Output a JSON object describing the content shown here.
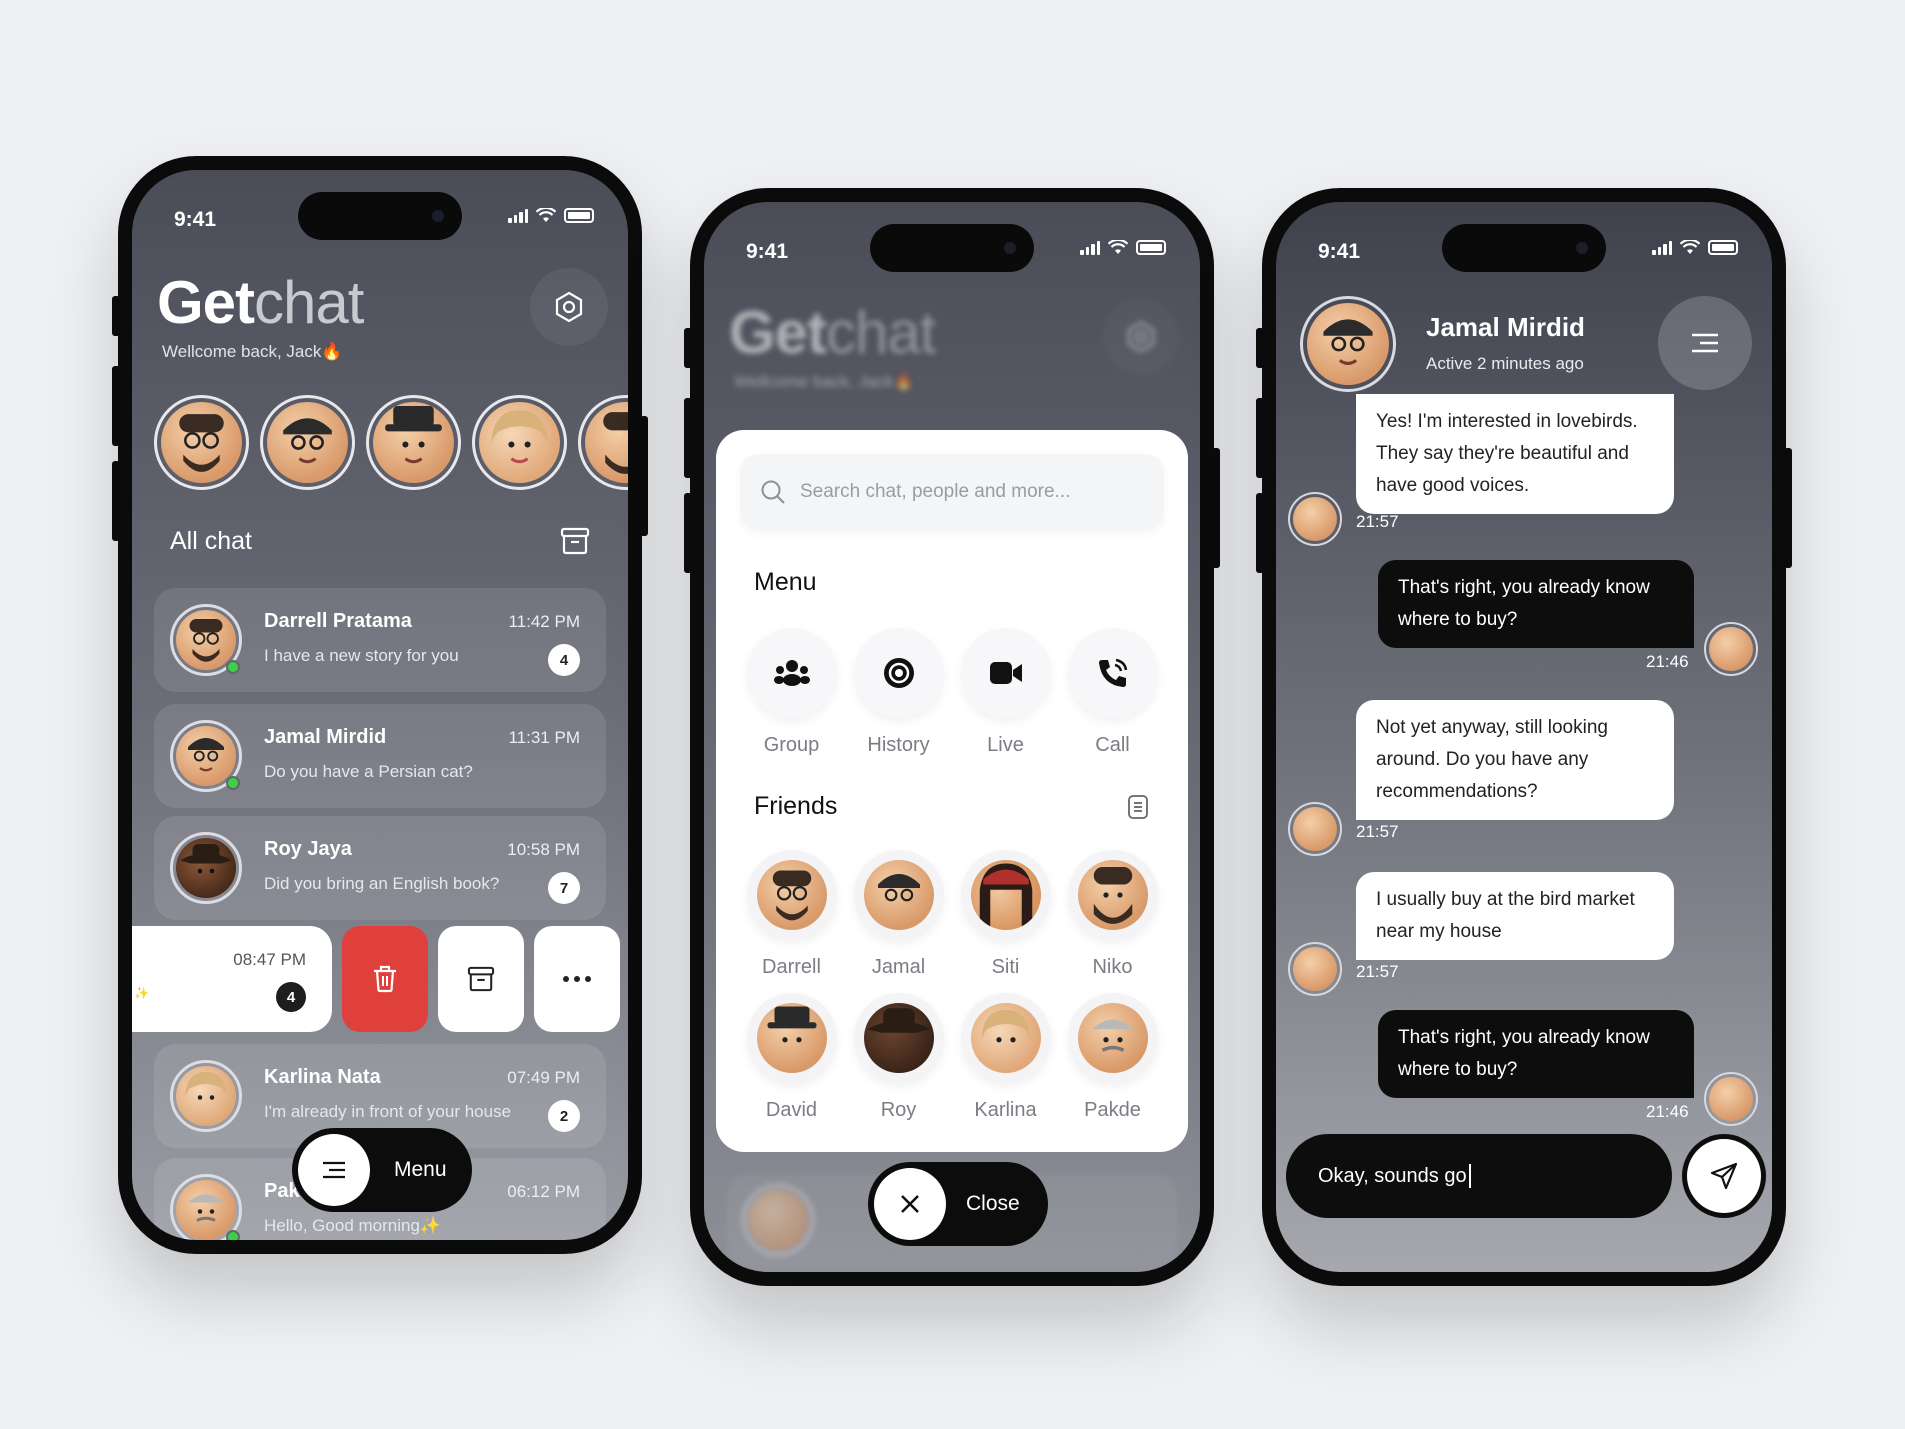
{
  "status_bar": {
    "time": "9:41"
  },
  "phone1": {
    "brand_bold": "Get",
    "brand_light": "chat",
    "welcome": "Wellcome back, Jack🔥",
    "section_title": "All chat",
    "chats": [
      {
        "name": "Darrell Pratama",
        "message": "I have a new story for you",
        "time": "11:42 PM",
        "badge": "4"
      },
      {
        "name": "Jamal Mirdid",
        "message": "Do you have a Persian cat?",
        "time": "11:31 PM",
        "badge": ""
      },
      {
        "name": "Roy Jaya",
        "message": "Did you bring an English book?",
        "time": "10:58 PM",
        "badge": "7"
      },
      {
        "name": "",
        "message": "",
        "time": "08:47 PM",
        "badge": "4"
      },
      {
        "name": "Karlina Nata",
        "message": "I'm already in front of your house",
        "time": "07:49 PM",
        "badge": "2"
      },
      {
        "name": "Pakde",
        "message": "Hello, Good morning✨",
        "time": "06:12 PM",
        "badge": ""
      }
    ],
    "fab_label": "Menu",
    "sparkle": "✨"
  },
  "phone2": {
    "search_placeholder": "Search chat, people and more...",
    "menu_title": "Menu",
    "menu_items": [
      "Group",
      "History",
      "Live",
      "Call"
    ],
    "friends_title": "Friends",
    "friends": [
      "Darrell",
      "Jamal",
      "Siti",
      "Niko",
      "David",
      "Roy",
      "Karlina",
      "Pakde"
    ],
    "close_label": "Close"
  },
  "phone3": {
    "contact_name": "Jamal Mirdid",
    "contact_status": "Active 2 minutes ago",
    "messages": [
      {
        "text": "Yes! I'm interested in lovebirds. They say they're beautiful and have good voices.",
        "time": "21:57"
      },
      {
        "text": "That's right, you already know where to buy?",
        "time": "21:46"
      },
      {
        "text": "Not yet anyway, still looking around. Do you have any recommendations?",
        "time": "21:57"
      },
      {
        "text": "I usually buy at the bird market near my house",
        "time": "21:57"
      },
      {
        "text": "That's right, you already know where to buy?",
        "time": "21:46"
      }
    ],
    "composer_text": "Okay, sounds go"
  },
  "colors": {
    "online": "#3ad04a",
    "delete": "#e0403b",
    "dark": "#0d0d0d"
  }
}
